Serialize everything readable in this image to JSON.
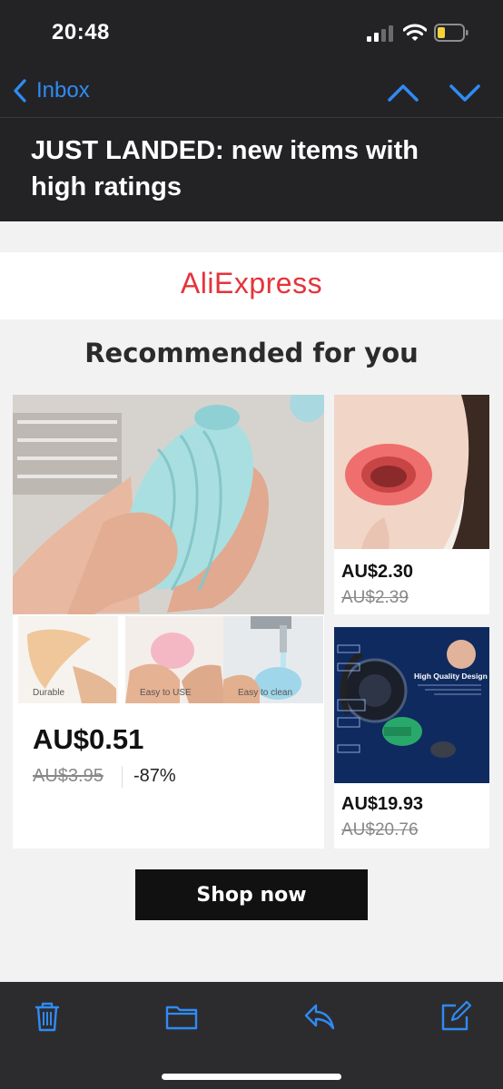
{
  "status_bar": {
    "time": "20:48",
    "icons": [
      "signal-icon",
      "wifi-icon",
      "battery-low-icon"
    ]
  },
  "nav": {
    "back_label": "Inbox",
    "icons": [
      "chevron-left-icon",
      "chevron-up-icon",
      "chevron-down-icon"
    ],
    "accent_color": "#2f8bf5"
  },
  "email": {
    "subject": "JUST LANDED: new items with high ratings",
    "brand": "AliExpress",
    "brand_color": "#e6333a",
    "section_title": "Recommended for you",
    "products": [
      {
        "price": "AU$0.51",
        "original_price": "AU$3.95",
        "discount": "-87%",
        "thumb_labels": [
          "Durable",
          "Easy to USE",
          "Easy to clean"
        ]
      },
      {
        "price": "AU$2.30",
        "original_price": "AU$2.39"
      },
      {
        "price": "AU$19.93",
        "original_price": "AU$20.76",
        "image_text": "High Quality Design"
      }
    ],
    "cta_label": "Shop now"
  },
  "toolbar": {
    "icons": [
      "trash-icon",
      "folder-icon",
      "reply-icon",
      "compose-icon"
    ]
  }
}
